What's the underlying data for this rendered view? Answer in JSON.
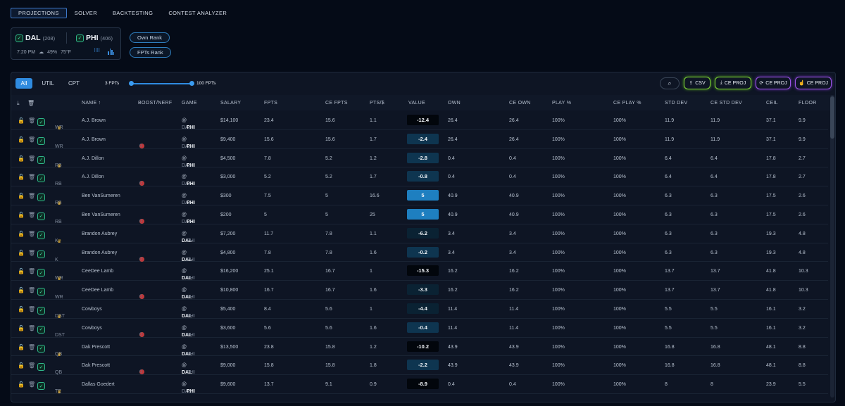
{
  "nav": {
    "tabs": [
      "PROJECTIONS",
      "SOLVER",
      "BACKTESTING",
      "CONTEST ANALYZER"
    ],
    "active": 0
  },
  "game": {
    "team1": {
      "name": "DAL",
      "count": "(208)"
    },
    "team2": {
      "name": "PHI",
      "count": "(406)"
    },
    "time": "7:20 PM",
    "precip": "49%",
    "temp": "75°F"
  },
  "rank_pills": [
    "Own Rank",
    "FPTs Rank"
  ],
  "filter_tabs": [
    "All",
    "UTIL",
    "CPT"
  ],
  "slider": {
    "min_label": "3 FPTs",
    "max_label": "100 FPTs"
  },
  "actions": {
    "csv": "CSV",
    "ce_proj_download": "CE PROJ",
    "ce_proj_sync": "CE PROJ",
    "ce_proj_upload": "CE PROJ"
  },
  "columns": [
    "NAME ↑",
    "BOOST/NERF",
    "GAME",
    "SALARY",
    "FPTS",
    "CE FPTS",
    "PTS/$",
    "VALUE",
    "OWN",
    "CE OWN",
    "PLAY %",
    "CE PLAY %",
    "STD DEV",
    "CE STD DEV",
    "CEIL",
    "FLOOR"
  ],
  "accent": "#2f8be0",
  "rows": [
    {
      "pos": "WR",
      "cpt": true,
      "name": "A.J. Brown",
      "boost": false,
      "team": "PHI",
      "game_pre": "DAL",
      "game_post": "PHI",
      "salary": "$14,100",
      "fpts": "23.4",
      "ce_fpts": "15.6",
      "pts": "1.1",
      "value": "-12.4",
      "own": "26.4",
      "ce_own": "26.4",
      "play": "100%",
      "ce_play": "100%",
      "std": "11.9",
      "ce_std": "11.9",
      "ceil": "37.1",
      "floor": "9.9"
    },
    {
      "pos": "WR",
      "cpt": false,
      "name": "A.J. Brown",
      "boost": true,
      "team": "PHI",
      "game_pre": "DAL",
      "game_post": "PHI",
      "salary": "$9,400",
      "fpts": "15.6",
      "ce_fpts": "15.6",
      "pts": "1.7",
      "value": "-2.4",
      "own": "26.4",
      "ce_own": "26.4",
      "play": "100%",
      "ce_play": "100%",
      "std": "11.9",
      "ce_std": "11.9",
      "ceil": "37.1",
      "floor": "9.9"
    },
    {
      "pos": "RB",
      "cpt": true,
      "name": "A.J. Dillon",
      "boost": false,
      "team": "PHI",
      "game_pre": "DAL",
      "game_post": "PHI",
      "salary": "$4,500",
      "fpts": "7.8",
      "ce_fpts": "5.2",
      "pts": "1.2",
      "value": "-2.8",
      "own": "0.4",
      "ce_own": "0.4",
      "play": "100%",
      "ce_play": "100%",
      "std": "6.4",
      "ce_std": "6.4",
      "ceil": "17.8",
      "floor": "2.7"
    },
    {
      "pos": "RB",
      "cpt": false,
      "name": "A.J. Dillon",
      "boost": true,
      "team": "PHI",
      "game_pre": "DAL",
      "game_post": "PHI",
      "salary": "$3,000",
      "fpts": "5.2",
      "ce_fpts": "5.2",
      "pts": "1.7",
      "value": "-0.8",
      "own": "0.4",
      "ce_own": "0.4",
      "play": "100%",
      "ce_play": "100%",
      "std": "6.4",
      "ce_std": "6.4",
      "ceil": "17.8",
      "floor": "2.7"
    },
    {
      "pos": "RB",
      "cpt": true,
      "name": "Ben VanSumeren",
      "boost": false,
      "team": "PHI",
      "game_pre": "DAL",
      "game_post": "PHI",
      "salary": "$300",
      "fpts": "7.5",
      "ce_fpts": "5",
      "pts": "16.6",
      "value": "5",
      "own": "40.9",
      "ce_own": "40.9",
      "play": "100%",
      "ce_play": "100%",
      "std": "6.3",
      "ce_std": "6.3",
      "ceil": "17.5",
      "floor": "2.6"
    },
    {
      "pos": "RB",
      "cpt": false,
      "name": "Ben VanSumeren",
      "boost": true,
      "team": "PHI",
      "game_pre": "DAL",
      "game_post": "PHI",
      "salary": "$200",
      "fpts": "5",
      "ce_fpts": "5",
      "pts": "25",
      "value": "5",
      "own": "40.9",
      "ce_own": "40.9",
      "play": "100%",
      "ce_play": "100%",
      "std": "6.3",
      "ce_std": "6.3",
      "ceil": "17.5",
      "floor": "2.6"
    },
    {
      "pos": "K",
      "cpt": true,
      "name": "Brandon Aubrey",
      "boost": false,
      "team": "DAL",
      "game_pre": "DAL",
      "game_post": "PHI",
      "salary": "$7,200",
      "fpts": "11.7",
      "ce_fpts": "7.8",
      "pts": "1.1",
      "value": "-6.2",
      "own": "3.4",
      "ce_own": "3.4",
      "play": "100%",
      "ce_play": "100%",
      "std": "6.3",
      "ce_std": "6.3",
      "ceil": "19.3",
      "floor": "4.8"
    },
    {
      "pos": "K",
      "cpt": false,
      "name": "Brandon Aubrey",
      "boost": true,
      "team": "DAL",
      "game_pre": "DAL",
      "game_post": "PHI",
      "salary": "$4,800",
      "fpts": "7.8",
      "ce_fpts": "7.8",
      "pts": "1.6",
      "value": "-0.2",
      "own": "3.4",
      "ce_own": "3.4",
      "play": "100%",
      "ce_play": "100%",
      "std": "6.3",
      "ce_std": "6.3",
      "ceil": "19.3",
      "floor": "4.8"
    },
    {
      "pos": "WR",
      "cpt": true,
      "name": "CeeDee Lamb",
      "boost": false,
      "team": "DAL",
      "game_pre": "DAL",
      "game_post": "PHI",
      "salary": "$16,200",
      "fpts": "25.1",
      "ce_fpts": "16.7",
      "pts": "1",
      "value": "-15.3",
      "own": "16.2",
      "ce_own": "16.2",
      "play": "100%",
      "ce_play": "100%",
      "std": "13.7",
      "ce_std": "13.7",
      "ceil": "41.8",
      "floor": "10.3"
    },
    {
      "pos": "WR",
      "cpt": false,
      "name": "CeeDee Lamb",
      "boost": true,
      "team": "DAL",
      "game_pre": "DAL",
      "game_post": "PHI",
      "salary": "$10,800",
      "fpts": "16.7",
      "ce_fpts": "16.7",
      "pts": "1.6",
      "value": "-3.3",
      "own": "16.2",
      "ce_own": "16.2",
      "play": "100%",
      "ce_play": "100%",
      "std": "13.7",
      "ce_std": "13.7",
      "ceil": "41.8",
      "floor": "10.3"
    },
    {
      "pos": "DST",
      "cpt": true,
      "name": "Cowboys",
      "boost": false,
      "team": "DAL",
      "game_pre": "DAL",
      "game_post": "PHI",
      "salary": "$5,400",
      "fpts": "8.4",
      "ce_fpts": "5.6",
      "pts": "1",
      "value": "-4.4",
      "own": "11.4",
      "ce_own": "11.4",
      "play": "100%",
      "ce_play": "100%",
      "std": "5.5",
      "ce_std": "5.5",
      "ceil": "16.1",
      "floor": "3.2"
    },
    {
      "pos": "DST",
      "cpt": false,
      "name": "Cowboys",
      "boost": true,
      "team": "DAL",
      "game_pre": "DAL",
      "game_post": "PHI",
      "salary": "$3,600",
      "fpts": "5.6",
      "ce_fpts": "5.6",
      "pts": "1.6",
      "value": "-0.4",
      "own": "11.4",
      "ce_own": "11.4",
      "play": "100%",
      "ce_play": "100%",
      "std": "5.5",
      "ce_std": "5.5",
      "ceil": "16.1",
      "floor": "3.2"
    },
    {
      "pos": "QB",
      "cpt": true,
      "name": "Dak Prescott",
      "boost": false,
      "team": "DAL",
      "game_pre": "DAL",
      "game_post": "PHI",
      "salary": "$13,500",
      "fpts": "23.8",
      "ce_fpts": "15.8",
      "pts": "1.2",
      "value": "-10.2",
      "own": "43.9",
      "ce_own": "43.9",
      "play": "100%",
      "ce_play": "100%",
      "std": "16.8",
      "ce_std": "16.8",
      "ceil": "48.1",
      "floor": "8.8"
    },
    {
      "pos": "QB",
      "cpt": false,
      "name": "Dak Prescott",
      "boost": true,
      "team": "DAL",
      "game_pre": "DAL",
      "game_post": "PHI",
      "salary": "$9,000",
      "fpts": "15.8",
      "ce_fpts": "15.8",
      "pts": "1.8",
      "value": "-2.2",
      "own": "43.9",
      "ce_own": "43.9",
      "play": "100%",
      "ce_play": "100%",
      "std": "16.8",
      "ce_std": "16.8",
      "ceil": "48.1",
      "floor": "8.8"
    },
    {
      "pos": "TE",
      "cpt": true,
      "name": "Dallas Goedert",
      "boost": false,
      "team": "PHI",
      "game_pre": "DAL",
      "game_post": "PHI",
      "salary": "$9,600",
      "fpts": "13.7",
      "ce_fpts": "9.1",
      "pts": "0.9",
      "value": "-8.9",
      "own": "0.4",
      "ce_own": "0.4",
      "play": "100%",
      "ce_play": "100%",
      "std": "8",
      "ce_std": "8",
      "ceil": "23.9",
      "floor": "5.5"
    }
  ]
}
